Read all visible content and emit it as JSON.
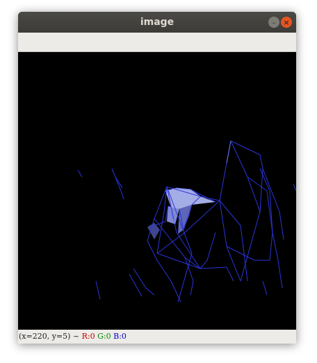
{
  "window": {
    "title": "image"
  },
  "titlebar": {
    "minimize_icon": "minimize-icon",
    "close_icon": "close-icon"
  },
  "status": {
    "coords": "(x=220, y=5) ~",
    "r": "R:0",
    "g": "G:0",
    "b": "B:0"
  },
  "colors": {
    "canvas_bg": "#000000",
    "wireframe": "#2a35d8",
    "highlight": "#b7bef5",
    "close_button": "#e95420"
  }
}
